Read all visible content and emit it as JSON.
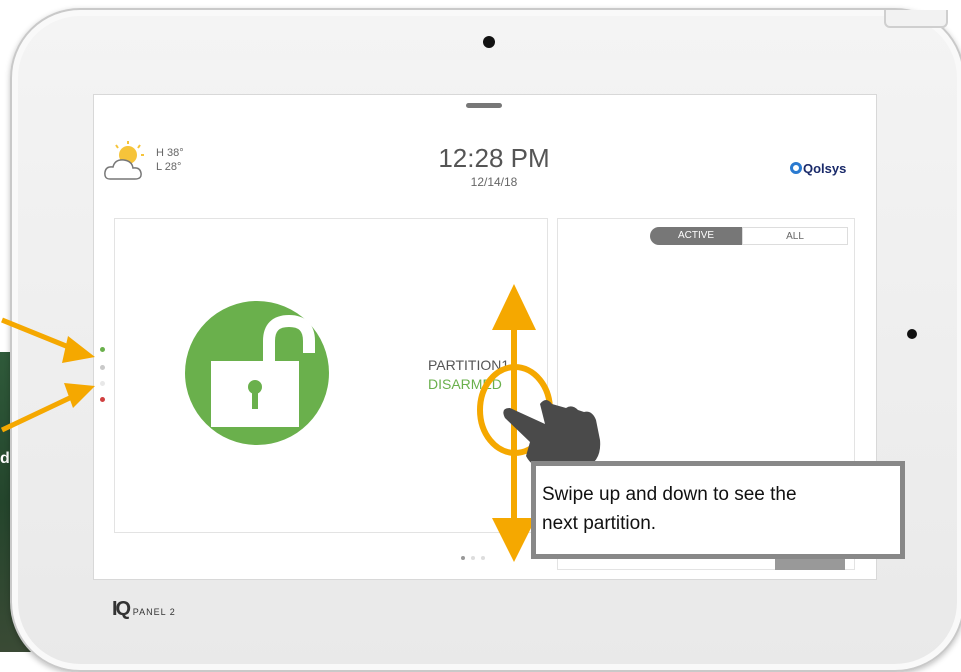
{
  "background": {
    "caption_fragment": "d"
  },
  "device": {
    "brand_ig": "IQ",
    "brand_sub": "PANEL 2"
  },
  "header": {
    "weather": {
      "high": "H 38°",
      "low": "L 28°"
    },
    "time": "12:28 PM",
    "date": "12/14/18",
    "logo_text": "Qolsys"
  },
  "partition": {
    "name": "PARTITION1",
    "status": "DISARMED"
  },
  "events_panel": {
    "tabs": [
      {
        "label": "ACTIVE",
        "selected": true
      },
      {
        "label": "ALL",
        "selected": false
      }
    ]
  },
  "callout": {
    "line1": "Swipe up and down to see the",
    "line2": "next partition."
  },
  "pager": {
    "pages": 3,
    "current": 1
  },
  "colors": {
    "accent_arrow": "#f5a800",
    "disarmed_green": "#6ab04c",
    "hand": "#4a4a4a"
  },
  "icons": [
    "sun-cloud-icon",
    "unlocked-padlock-icon",
    "hand-swipe-icon",
    "arrow-icon"
  ]
}
